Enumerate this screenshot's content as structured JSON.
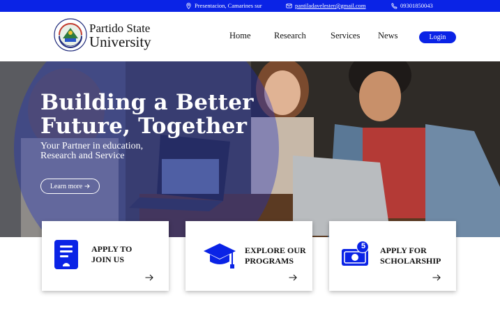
{
  "topbar": {
    "address": "Presentacion, Camarines sur",
    "email": "pantiladavelester@gmail.com",
    "phone": "09301850043",
    "icons": [
      "location-pin-icon",
      "envelope-icon",
      "phone-icon"
    ]
  },
  "brand": {
    "line1": "Partido State",
    "line2": "University",
    "seal_text": "PARTIDO STATE UNIVERSITY · CAMARINES SUR"
  },
  "nav": {
    "items": [
      "Home",
      "Research",
      "Services",
      "News"
    ],
    "login": "Login"
  },
  "hero": {
    "title_line1": "Building a Better",
    "title_line2": "Future, Together",
    "subtitle_line1": "Your Partner in education,",
    "subtitle_line2": "Research and Service",
    "cta": "Learn more",
    "cta_icon": "arrow-right-icon"
  },
  "cards": [
    {
      "line1": "APPLY TO",
      "line2": "JOIN US",
      "icon": "application-form-icon"
    },
    {
      "line1": "EXPLORE OUR",
      "line2": "PROGRAMS",
      "icon": "graduation-cap-icon"
    },
    {
      "line1": "APPLY FOR",
      "line2": "SCHOLARSHIP",
      "icon": "money-badge-icon",
      "badge": "5"
    }
  ],
  "colors": {
    "brand_blue": "#0a23e6",
    "white": "#ffffff",
    "text": "#111111"
  }
}
